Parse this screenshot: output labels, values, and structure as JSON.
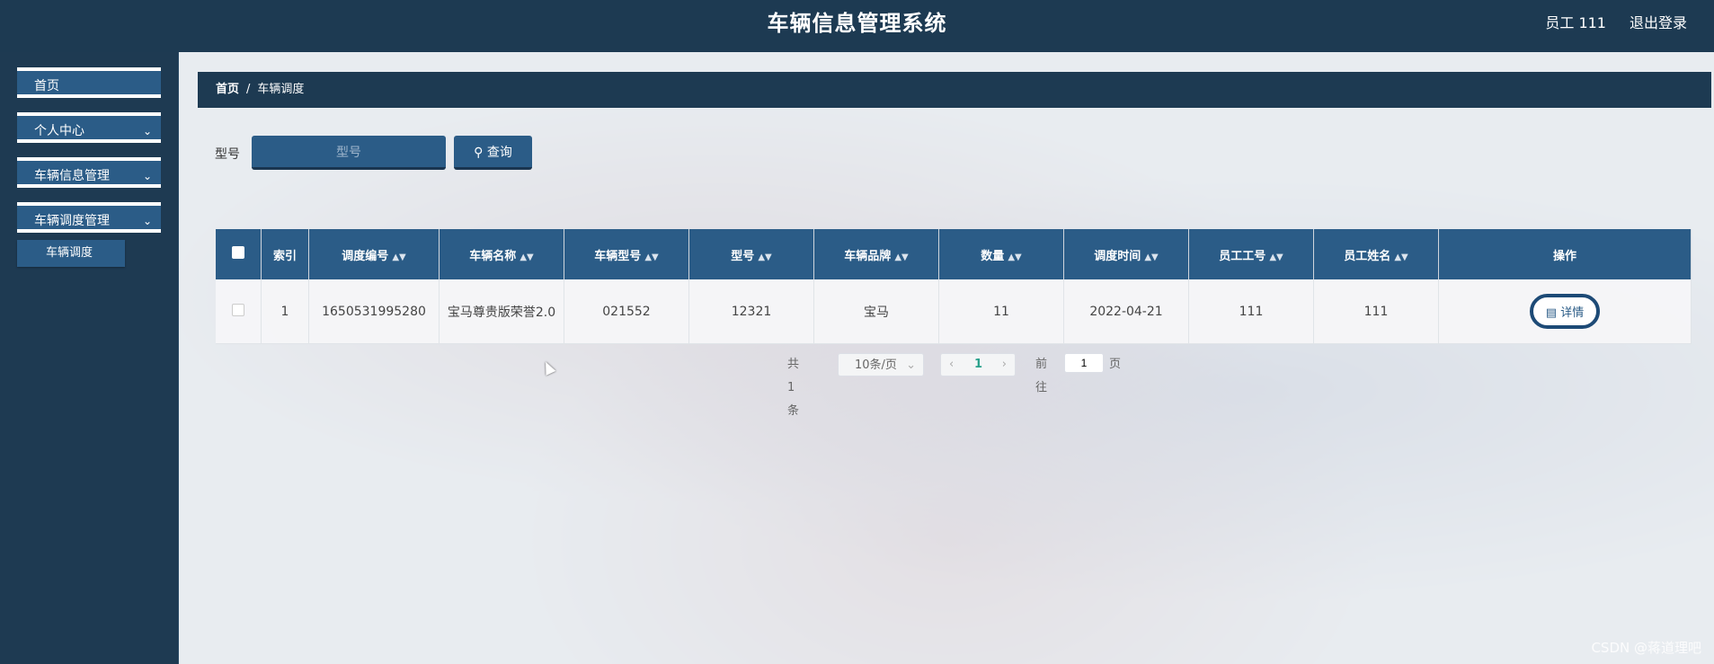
{
  "header": {
    "title": "车辆信息管理系统",
    "user": "员工 111",
    "logout": "退出登录"
  },
  "sidebar": {
    "items": [
      {
        "label": "首页",
        "chevron": ""
      },
      {
        "label": "个人中心",
        "chevron": "⌄"
      },
      {
        "label": "车辆信息管理",
        "chevron": "⌄"
      },
      {
        "label": "车辆调度管理",
        "chevron": "⌄"
      }
    ],
    "subitem": "车辆调度"
  },
  "breadcrumb": {
    "home": "首页",
    "sep": "/",
    "current": "车辆调度"
  },
  "search": {
    "label": "型号",
    "placeholder": "型号",
    "button": "查询"
  },
  "table": {
    "headers": [
      "索引",
      "调度编号",
      "车辆名称",
      "车辆型号",
      "型号",
      "车辆品牌",
      "数量",
      "调度时间",
      "员工工号",
      "员工姓名",
      "操作"
    ],
    "rows": [
      [
        "1",
        "1650531995280",
        "宝马尊贵版荣誉2.0",
        "021552",
        "12321",
        "宝马",
        "11",
        "2022-04-21",
        "111",
        "111"
      ]
    ],
    "action": "详情"
  },
  "pagination": {
    "total": "共 1 条",
    "page_size": "10条/页",
    "current": "1",
    "goto_label": "前往",
    "goto_value": "1",
    "page_suffix": "页"
  },
  "watermark": "CSDN @蒋道理吧"
}
